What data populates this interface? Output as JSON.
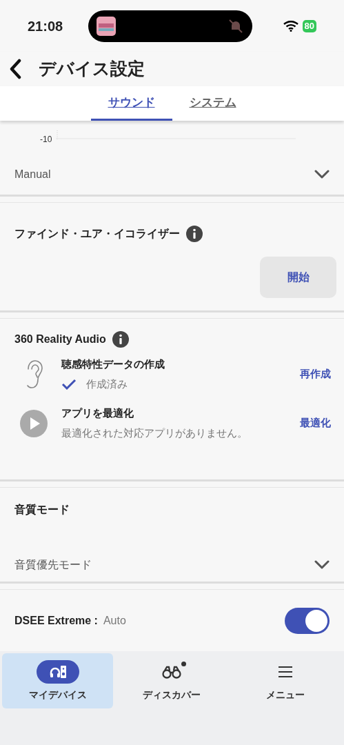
{
  "status_bar": {
    "time": "21:08",
    "battery": "80"
  },
  "header": {
    "title": "デバイス設定"
  },
  "tabs": [
    {
      "label": "サウンド",
      "selected": true
    },
    {
      "label": "システム",
      "selected": false
    }
  ],
  "chart_axis": {
    "label": "-10"
  },
  "preset": {
    "value": "Manual"
  },
  "find_your_equalizer": {
    "title": "ファインド・ユア・イコライザー",
    "button": "開始"
  },
  "reality_audio": {
    "title": "360 Reality Audio",
    "items": [
      {
        "kind": "ear",
        "title": "聴感特性データの作成",
        "status": "作成済み",
        "checked": true,
        "action": "再作成"
      },
      {
        "kind": "play",
        "title": "アプリを最適化",
        "status": "最適化された対応アプリがありません。",
        "checked": false,
        "action": "最適化"
      }
    ]
  },
  "sound_quality": {
    "title": "音質モード",
    "value": "音質優先モード"
  },
  "dsee": {
    "label": "DSEE Extreme :",
    "value": "Auto",
    "on": true
  },
  "bottom_nav": [
    {
      "kind": "device",
      "label": "マイデバイス",
      "selected": true,
      "dot": false
    },
    {
      "kind": "discover",
      "label": "ディスカバー",
      "selected": false,
      "dot": true
    },
    {
      "kind": "menu",
      "label": "メニュー",
      "selected": false,
      "dot": false
    }
  ]
}
